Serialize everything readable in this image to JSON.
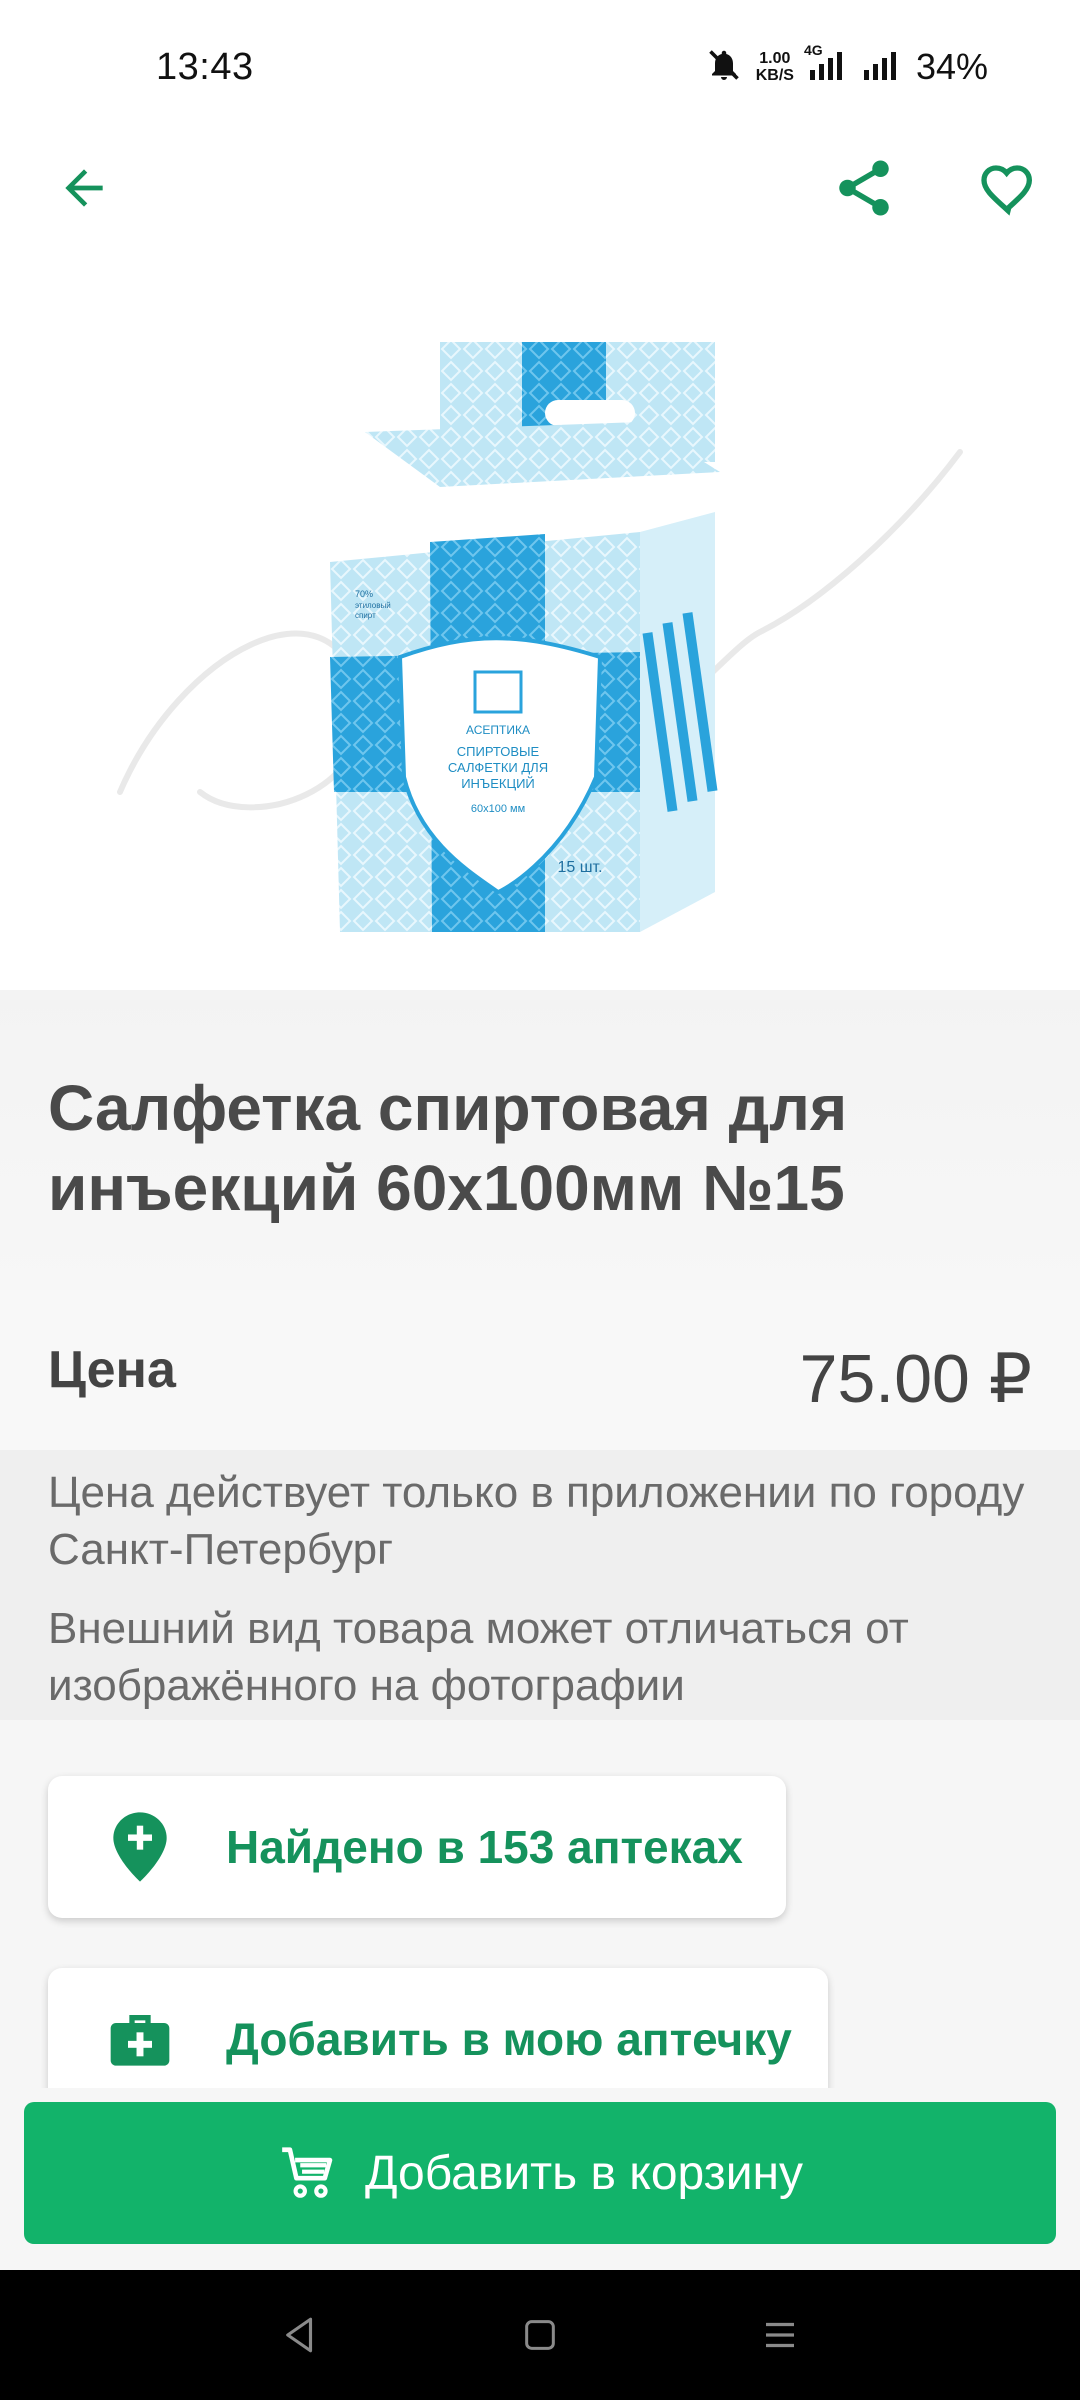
{
  "status_bar": {
    "time": "13:43",
    "net_speed_value": "1.00",
    "net_speed_unit": "KB/S",
    "network_type": "4G",
    "battery": "34%",
    "icons": [
      "mute-bell-icon",
      "signal-4g-icon",
      "signal-icon"
    ]
  },
  "app_bar": {
    "icons": [
      "back-arrow-icon",
      "share-icon",
      "heart-icon"
    ],
    "accent": "#15925c"
  },
  "product": {
    "image_icon": "alcohol-wipes-box-image",
    "title": "Салфетка спиртовая для инъекций 60х100мм №15",
    "price_label": "Цена",
    "price_value": "75.00 ₽",
    "note_price": "Цена действует только в приложении по городу Санкт-Петербург",
    "note_image": "Внешний вид товара может отличаться от изображённого на фотографии"
  },
  "actions": {
    "found_label": "Найдено в 153 аптеках",
    "found_icon": "pin-plus-icon",
    "kit_label": "Добавить в мою аптечку",
    "kit_icon": "first-aid-kit-icon",
    "cart_label": "Добавить в корзину",
    "cart_icon": "cart-icon",
    "cart_color": "#12b36a"
  },
  "nav_bar": {
    "icons": [
      "back-triangle-icon",
      "home-square-icon",
      "menu-lines-icon"
    ]
  }
}
